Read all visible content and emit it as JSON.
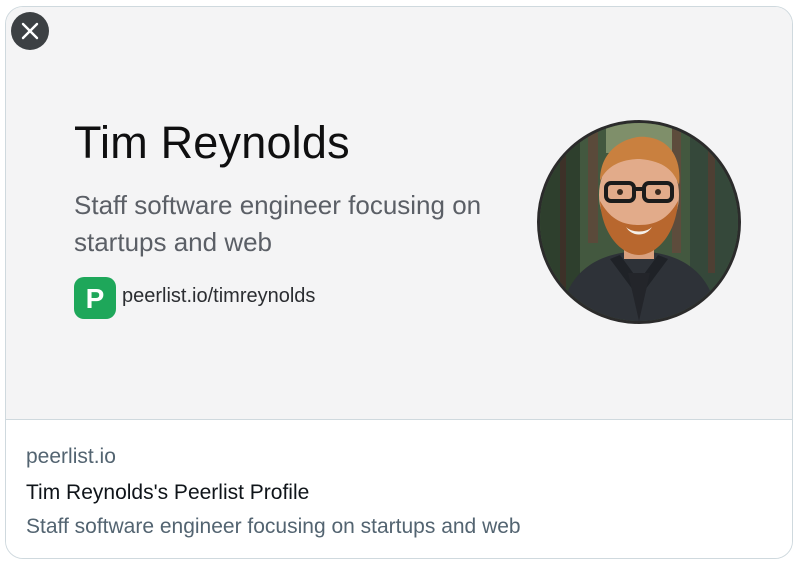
{
  "preview": {
    "name": "Tim Reynolds",
    "bio": "Staff software engineer focusing on startups and web",
    "logo_letter": "P",
    "logo_icon": "peerlist-logo-icon",
    "url": "peerlist.io/timreynolds",
    "avatar": "profile-photo",
    "close_icon": "close-icon"
  },
  "footer": {
    "domain": "peerlist.io",
    "title": "Tim Reynolds's Peerlist Profile",
    "description": "Staff software engineer focusing on startups and web"
  },
  "colors": {
    "brand_green": "#1ea75a",
    "preview_bg": "#f4f4f5",
    "close_bg": "#3c4043"
  }
}
